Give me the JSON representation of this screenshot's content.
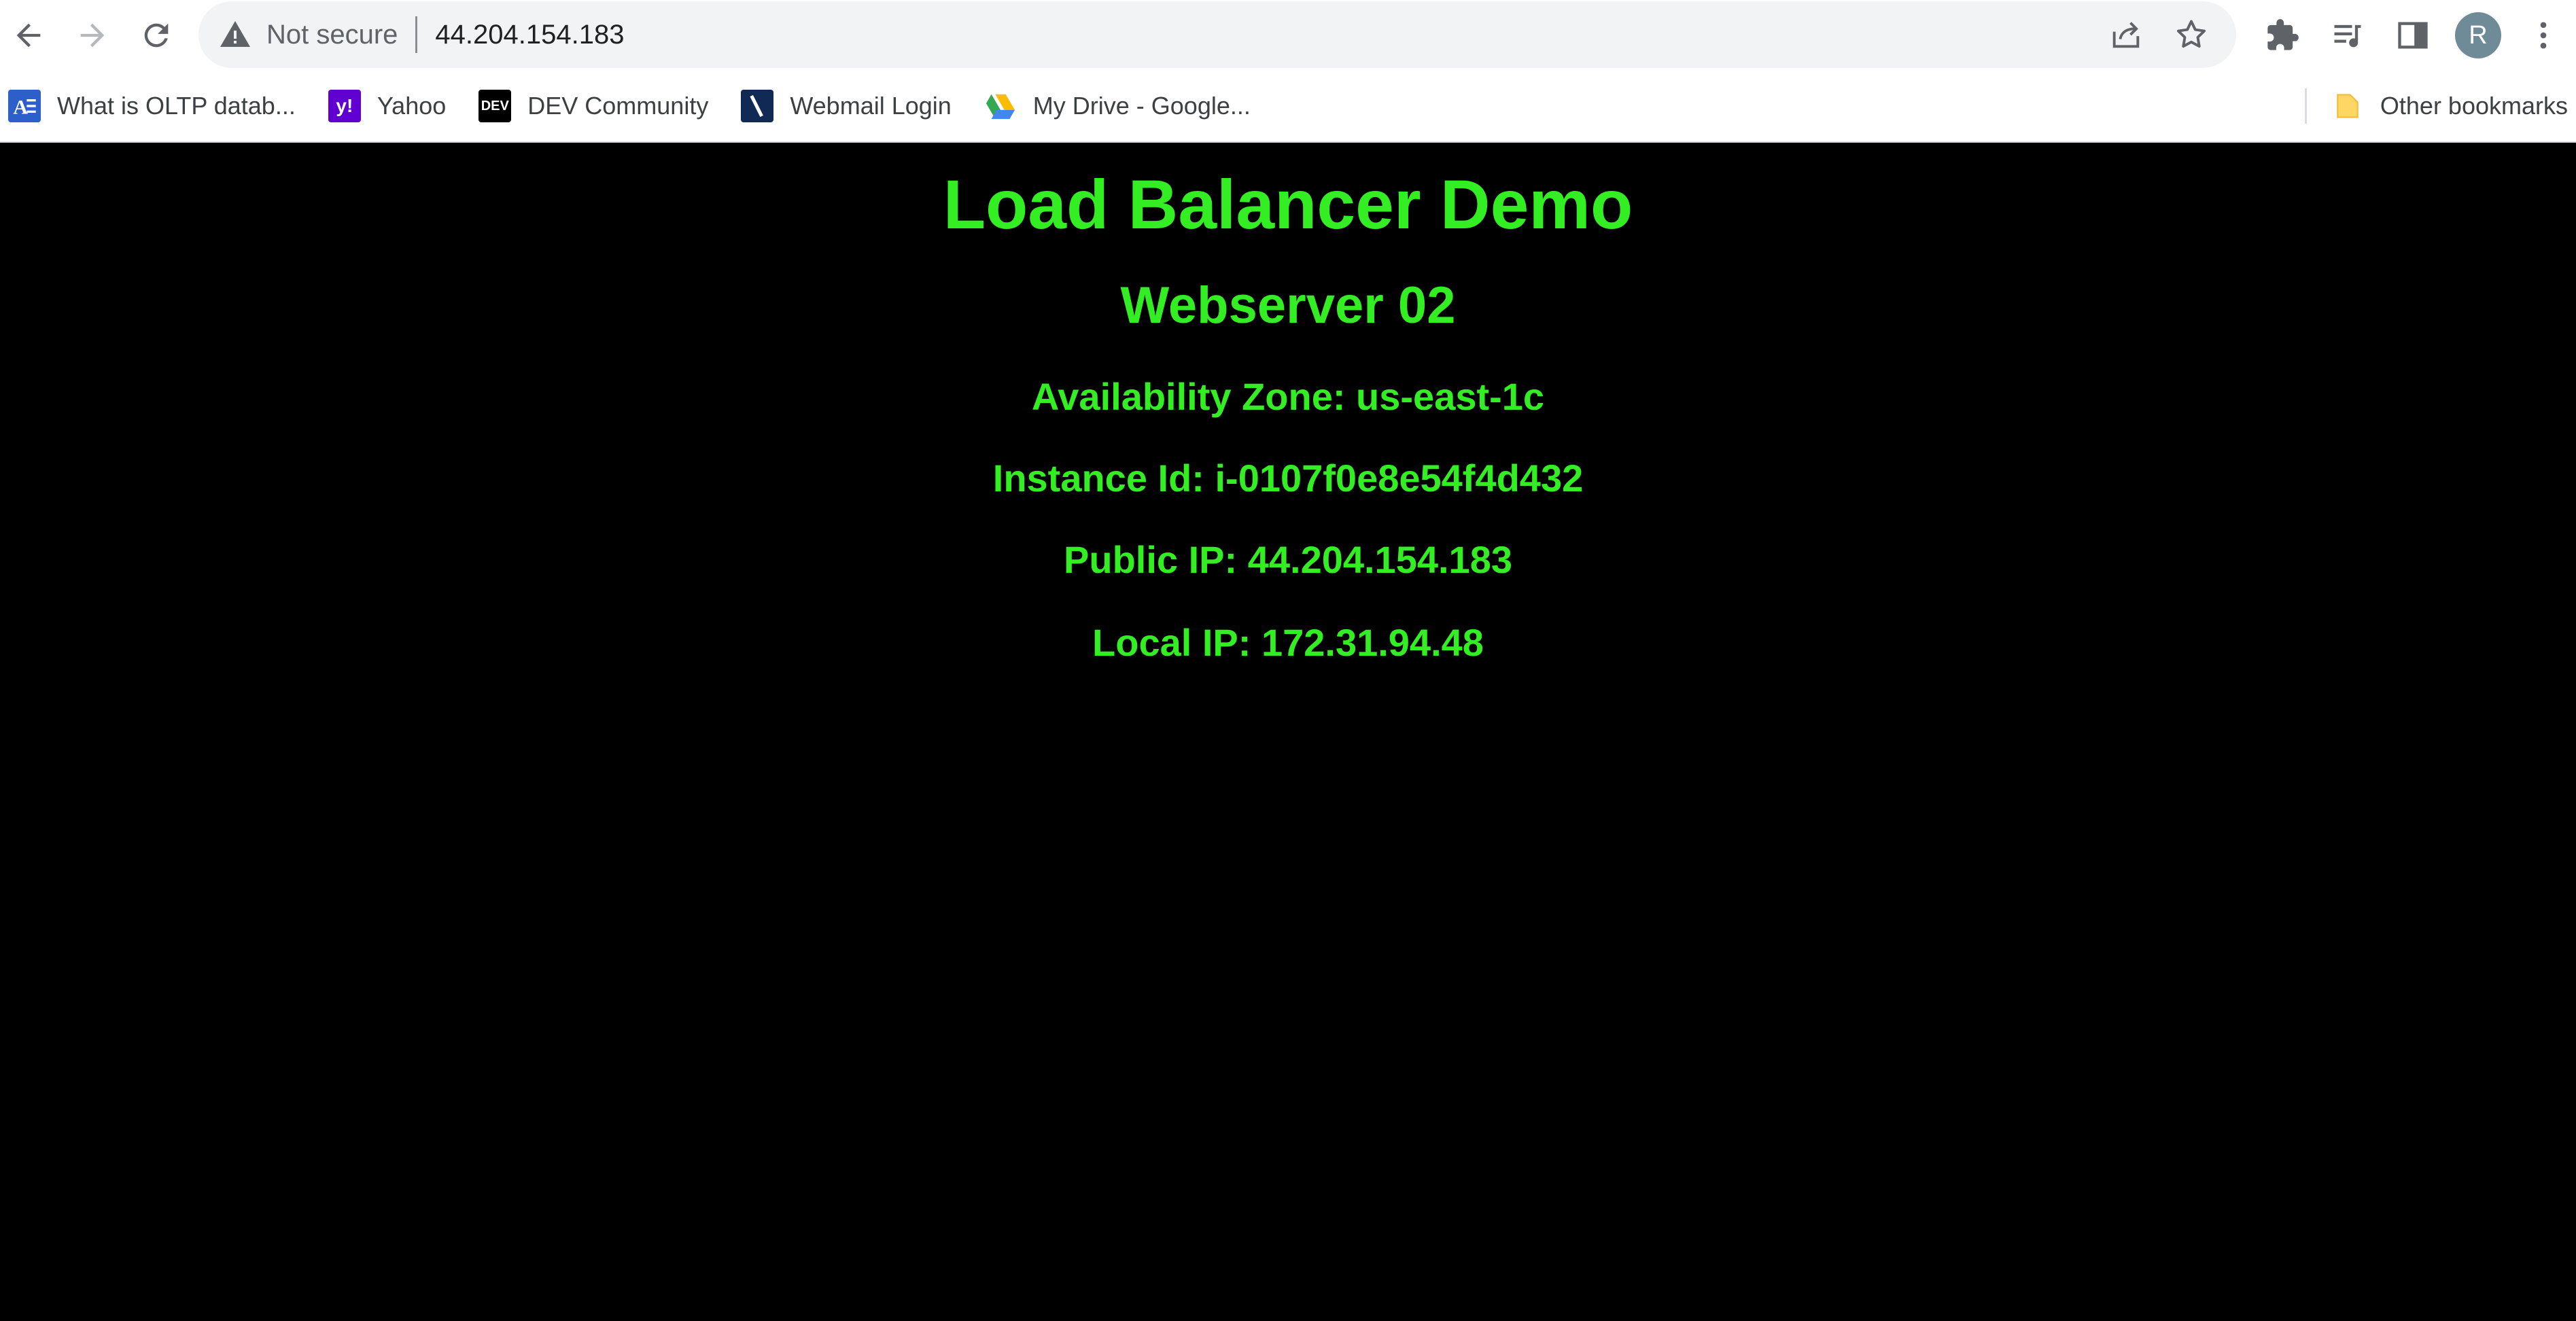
{
  "browser": {
    "security_label": "Not secure",
    "url": "44.204.154.183",
    "profile_initial": "R"
  },
  "bookmarks": {
    "items": [
      {
        "label": "What is OLTP datab...",
        "icon": "oltp-favicon"
      },
      {
        "label": "Yahoo",
        "icon": "yahoo-favicon",
        "icon_text": "y!"
      },
      {
        "label": "DEV Community",
        "icon": "dev-favicon",
        "icon_text": "DEV"
      },
      {
        "label": "Webmail Login",
        "icon": "webmail-favicon"
      },
      {
        "label": "My Drive - Google...",
        "icon": "google-drive-favicon"
      }
    ],
    "other": {
      "label": "Other bookmarks",
      "icon": "folder-icon"
    }
  },
  "page": {
    "title": "Load Balancer Demo",
    "server": "Webserver 02",
    "availability_zone": "Availability Zone: us-east-1c",
    "instance_id": "Instance Id: i-0107f0e8e54f4d432",
    "public_ip": "Public IP: 44.204.154.183",
    "local_ip": "Local IP: 172.31.94.48"
  },
  "colors": {
    "page_background": "#000000",
    "page_text": "#33ee22",
    "toolbar_background": "#ffffff",
    "omnibox_background": "#f1f3f4"
  }
}
